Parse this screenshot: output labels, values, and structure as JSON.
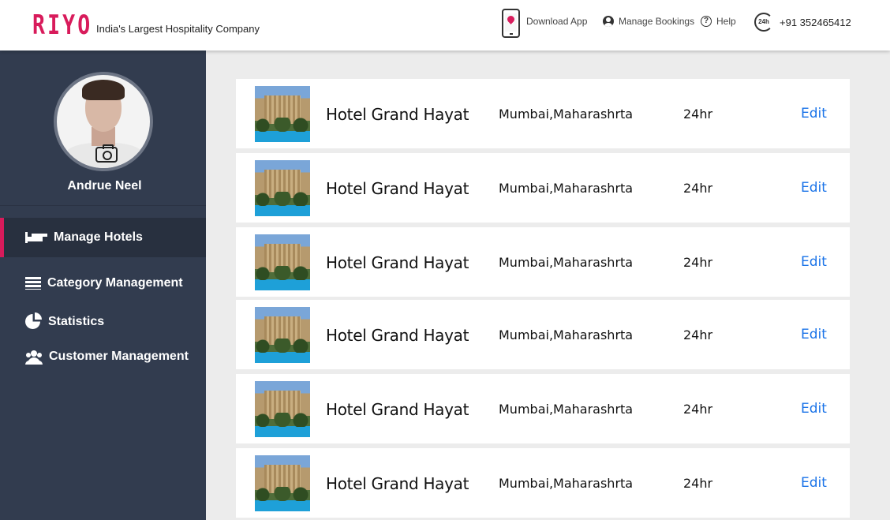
{
  "header": {
    "logo": "RIYO",
    "tagline": "India's Largest Hospitality Company",
    "download_app": "Download App",
    "manage_bookings": "Manage Bookings",
    "help": "Help",
    "hours_badge": "24h",
    "phone": "+91 352465412"
  },
  "sidebar": {
    "user_name": "Andrue Neel",
    "items": [
      {
        "label": "Manage Hotels",
        "icon": "bed-icon",
        "active": true
      },
      {
        "label": "Category Management",
        "icon": "list-icon",
        "active": false
      },
      {
        "label": "Statistics",
        "icon": "pie-chart-icon",
        "active": false
      },
      {
        "label": "Customer Management",
        "icon": "users-icon",
        "active": false
      }
    ]
  },
  "hotels": [
    {
      "name": "Hotel Grand Hayat",
      "location": "Mumbai,Maharashrta",
      "duration": "24hr",
      "action": "Edit"
    },
    {
      "name": "Hotel Grand Hayat",
      "location": "Mumbai,Maharashrta",
      "duration": "24hr",
      "action": "Edit"
    },
    {
      "name": "Hotel Grand Hayat",
      "location": "Mumbai,Maharashrta",
      "duration": "24hr",
      "action": "Edit"
    },
    {
      "name": "Hotel Grand Hayat",
      "location": "Mumbai,Maharashrta",
      "duration": "24hr",
      "action": "Edit"
    },
    {
      "name": "Hotel Grand Hayat",
      "location": "Mumbai,Maharashrta",
      "duration": "24hr",
      "action": "Edit"
    },
    {
      "name": "Hotel Grand Hayat",
      "location": "Mumbai,Maharashrta",
      "duration": "24hr",
      "action": "Edit"
    }
  ],
  "colors": {
    "brand": "#d81b5b",
    "sidebar_bg": "#323c4f",
    "link": "#1a73e8"
  }
}
